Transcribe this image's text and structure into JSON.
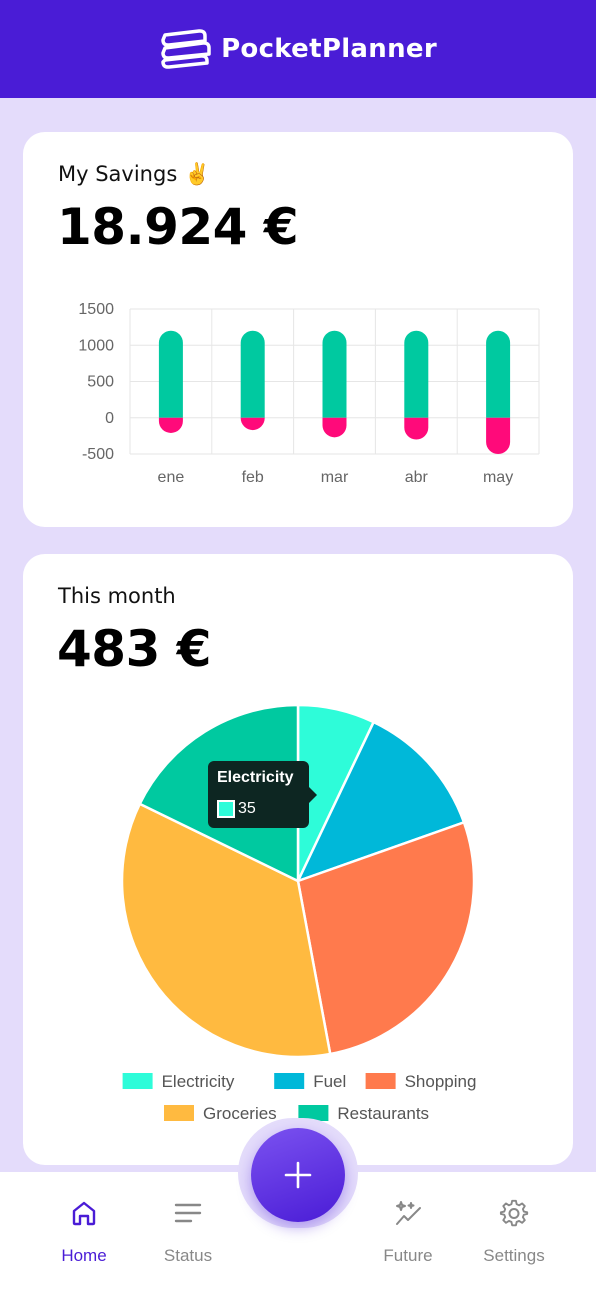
{
  "app": {
    "title": "PocketPlanner"
  },
  "savings": {
    "label": "My Savings ✌️",
    "amount": "18.924 €",
    "chart_data": {
      "type": "bar",
      "stacked": true,
      "categories": [
        "ene",
        "feb",
        "mar",
        "abr",
        "may"
      ],
      "series": [
        {
          "values": [
            1200,
            1200,
            1200,
            1200,
            1200
          ],
          "color": "#00c9a0"
        },
        {
          "values": [
            -210,
            -170,
            -270,
            -300,
            -500
          ],
          "color": "#ff0a7a"
        }
      ],
      "yticks": [
        1500,
        1000,
        500,
        0,
        -500
      ],
      "ylim": [
        -500,
        1500
      ],
      "grid": true
    }
  },
  "month": {
    "label": "This month",
    "amount": "483 €",
    "chart_data": {
      "type": "pie",
      "labels": [
        "Electricity",
        "Fuel",
        "Shopping",
        "Groceries",
        "Restaurants"
      ],
      "values": [
        35,
        62,
        136,
        174,
        88
      ],
      "colors": [
        "#2efcd9",
        "#00b8d9",
        "#ff7a4d",
        "#ffba40",
        "#00c9a0"
      ],
      "legend_position": "bottom"
    },
    "tooltip": {
      "title": "Electricity",
      "value": "35",
      "color": "#2efcd9"
    }
  },
  "nav": {
    "items": [
      {
        "label": "Home",
        "icon": "home-icon",
        "active": true
      },
      {
        "label": "Status",
        "icon": "list-icon",
        "active": false
      },
      {
        "label": "Future",
        "icon": "sparkle-trend-icon",
        "active": false
      },
      {
        "label": "Settings",
        "icon": "gear-icon",
        "active": false
      }
    ],
    "add_button": {
      "icon": "plus-icon"
    }
  },
  "colors": {
    "brand": "#4a1cd6",
    "background": "#e4dcfb"
  }
}
